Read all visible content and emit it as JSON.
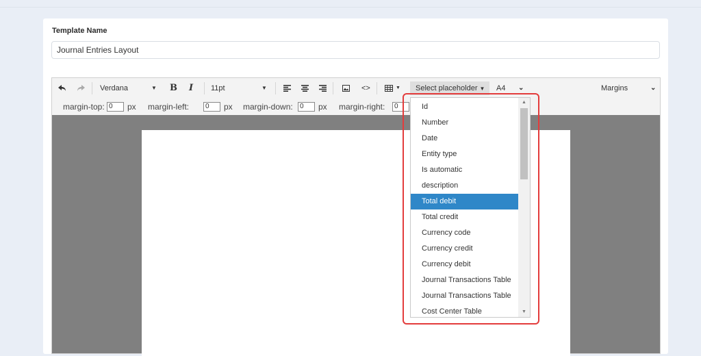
{
  "form": {
    "template_name_label": "Template Name",
    "template_name_value": "Journal Entries Layout"
  },
  "toolbar": {
    "undo_icon": "undo-icon",
    "redo_icon": "redo-icon",
    "font_family": "Verdana",
    "bold": "B",
    "italic": "I",
    "font_size": "11pt",
    "code_label": "<>",
    "placeholder_label": "Select placeholder",
    "page_size": "A4",
    "margins_label": "Margins"
  },
  "margins": {
    "top_label": "margin-top:",
    "top_value": "0",
    "left_label": "margin-left:",
    "left_value": "0",
    "down_label": "margin-down:",
    "down_value": "0",
    "right_label": "margin-right:",
    "right_value": "0",
    "unit": "px"
  },
  "placeholder_dropdown": {
    "items": [
      "Id",
      "Number",
      "Date",
      "Entity type",
      "Is automatic",
      "description",
      "Total debit",
      "Total credit",
      "Currency code",
      "Currency credit",
      "Currency debit",
      "Journal Transactions Table",
      "Journal Transactions Table",
      "Cost Center Table"
    ],
    "selected": "Total debit",
    "highlight_color": "#2f87c8",
    "outline_color": "#e33b3b"
  }
}
